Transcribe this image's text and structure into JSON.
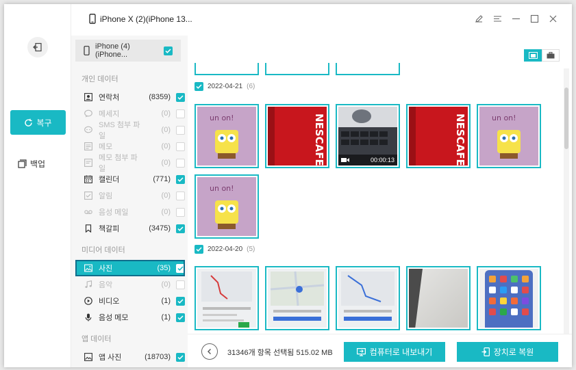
{
  "colors": {
    "accent": "#19b9c4",
    "active_outline": "#0f6e8c"
  },
  "titlebar": {
    "device_name": "iPhone X (2)(iPhone 13..."
  },
  "rail": {
    "recover_label": "복구",
    "backup_label": "백업"
  },
  "panel": {
    "device": "iPhone (4)(iPhone...",
    "section_personal": "개인 데이터",
    "section_media": "미디어 데이터",
    "section_app": "앱 데이터",
    "personal": [
      {
        "label": "연락처",
        "count": "(8359)",
        "checked": true,
        "dim": false,
        "icon": "contact-icon"
      },
      {
        "label": "메세지",
        "count": "(0)",
        "checked": false,
        "dim": true,
        "icon": "message-icon"
      },
      {
        "label": "SMS 첨부 파일",
        "count": "(0)",
        "checked": false,
        "dim": true,
        "icon": "sms-attachment-icon"
      },
      {
        "label": "메모",
        "count": "(0)",
        "checked": false,
        "dim": true,
        "icon": "note-icon"
      },
      {
        "label": "메모 첨부 파일",
        "count": "(0)",
        "checked": false,
        "dim": true,
        "icon": "note-attachment-icon"
      },
      {
        "label": "캘린더",
        "count": "(771)",
        "checked": true,
        "dim": false,
        "icon": "calendar-icon"
      },
      {
        "label": "알림",
        "count": "(0)",
        "checked": false,
        "dim": true,
        "icon": "reminder-icon"
      },
      {
        "label": "음성 메일",
        "count": "(0)",
        "checked": false,
        "dim": true,
        "icon": "voicemail-icon"
      },
      {
        "label": "책갈피",
        "count": "(3475)",
        "checked": true,
        "dim": false,
        "icon": "bookmark-icon"
      }
    ],
    "media": [
      {
        "label": "사진",
        "count": "(35)",
        "checked": true,
        "dim": false,
        "active": true,
        "icon": "photo-icon"
      },
      {
        "label": "음악",
        "count": "(0)",
        "checked": false,
        "dim": true,
        "icon": "music-icon"
      },
      {
        "label": "비디오",
        "count": "(1)",
        "checked": true,
        "dim": false,
        "icon": "video-icon"
      },
      {
        "label": "음성 메모",
        "count": "(1)",
        "checked": true,
        "dim": false,
        "icon": "voice-memo-icon"
      }
    ],
    "app": [
      {
        "label": "앱 사진",
        "count": "(18703)",
        "checked": true,
        "dim": false,
        "icon": "app-photo-icon"
      }
    ]
  },
  "content": {
    "groups": [
      {
        "date": "2022-04-21",
        "count": "(6)"
      },
      {
        "date": "2022-04-20",
        "count": "(5)"
      }
    ],
    "video_duration": "00:00:13"
  },
  "footer": {
    "summary": "31346개 항목 선택됨 515.02 MB",
    "export_label": "컴퓨터로 내보내기",
    "restore_label": "장치로 복원"
  }
}
